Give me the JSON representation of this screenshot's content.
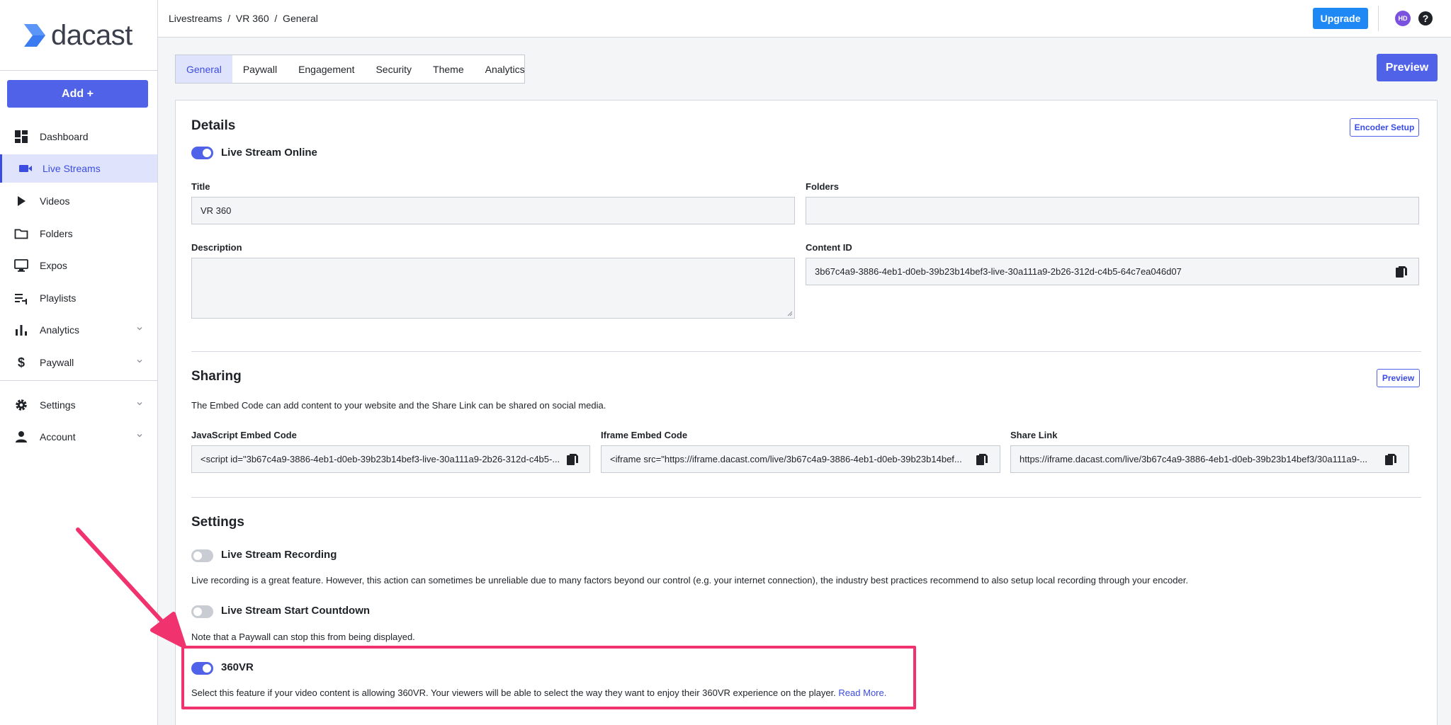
{
  "sidebar": {
    "logo_text": "dacast",
    "add_button": "Add +",
    "items": [
      {
        "label": "Dashboard",
        "icon": "dashboard-icon",
        "active": false
      },
      {
        "label": "Live Streams",
        "icon": "video-camera-icon",
        "active": true
      },
      {
        "label": "Videos",
        "icon": "play-icon",
        "active": false
      },
      {
        "label": "Folders",
        "icon": "folder-icon",
        "active": false
      },
      {
        "label": "Expos",
        "icon": "monitor-icon",
        "active": false
      },
      {
        "label": "Playlists",
        "icon": "playlist-icon",
        "active": false
      },
      {
        "label": "Analytics",
        "icon": "bar-chart-icon",
        "active": false,
        "expandable": true
      },
      {
        "label": "Paywall",
        "icon": "dollar-icon",
        "active": false,
        "expandable": true
      },
      {
        "label": "Settings",
        "icon": "gear-icon",
        "active": false,
        "expandable": true
      },
      {
        "label": "Account",
        "icon": "person-icon",
        "active": false,
        "expandable": true
      }
    ]
  },
  "topbar": {
    "breadcrumb": "Livestreams  /  VR 360  /  General",
    "upgrade": "Upgrade",
    "avatar_initials": "HD"
  },
  "tabs": [
    "General",
    "Paywall",
    "Engagement",
    "Security",
    "Theme",
    "Analytics"
  ],
  "preview_button": "Preview",
  "details": {
    "title": "Details",
    "encoder_setup": "Encoder Setup",
    "online_toggle_label": "Live Stream Online",
    "title_label": "Title",
    "title_value": "VR 360",
    "folders_label": "Folders",
    "folders_value": "",
    "description_label": "Description",
    "description_value": "",
    "content_id_label": "Content ID",
    "content_id_value": "3b67c4a9-3886-4eb1-d0eb-39b23b14bef3-live-30a111a9-2b26-312d-c4b5-64c7ea046d07"
  },
  "sharing": {
    "title": "Sharing",
    "preview": "Preview",
    "description": "The Embed Code can add content to your website and the Share Link can be shared on social media.",
    "js_label": "JavaScript Embed Code",
    "js_value": "<script id=\"3b67c4a9-3886-4eb1-d0eb-39b23b14bef3-live-30a111a9-2b26-312d-c4b5-...",
    "iframe_label": "Iframe Embed Code",
    "iframe_value": "<iframe src=\"https://iframe.dacast.com/live/3b67c4a9-3886-4eb1-d0eb-39b23b14bef...",
    "share_label": "Share Link",
    "share_value": "https://iframe.dacast.com/live/3b67c4a9-3886-4eb1-d0eb-39b23b14bef3/30a111a9-..."
  },
  "settings": {
    "title": "Settings",
    "recording_label": "Live Stream Recording",
    "recording_on": false,
    "recording_note": "Live recording is a great feature. However, this action can sometimes be unreliable due to many factors beyond our control (e.g. your internet connection), the industry best practices recommend to also setup local recording through your encoder.",
    "countdown_label": "Live Stream Start Countdown",
    "countdown_on": false,
    "countdown_note": "Note that a Paywall can stop this from being displayed.",
    "vr_label": "360VR",
    "vr_on": true,
    "vr_note": "Select this feature if your video content is allowing 360VR. Your viewers will be able to select the way they want to enjoy their 360VR experience on the player.",
    "vr_link": "Read More."
  },
  "colors": {
    "accent": "#4f62e8",
    "upgrade": "#1e88f5",
    "highlight": "#f0336e"
  }
}
